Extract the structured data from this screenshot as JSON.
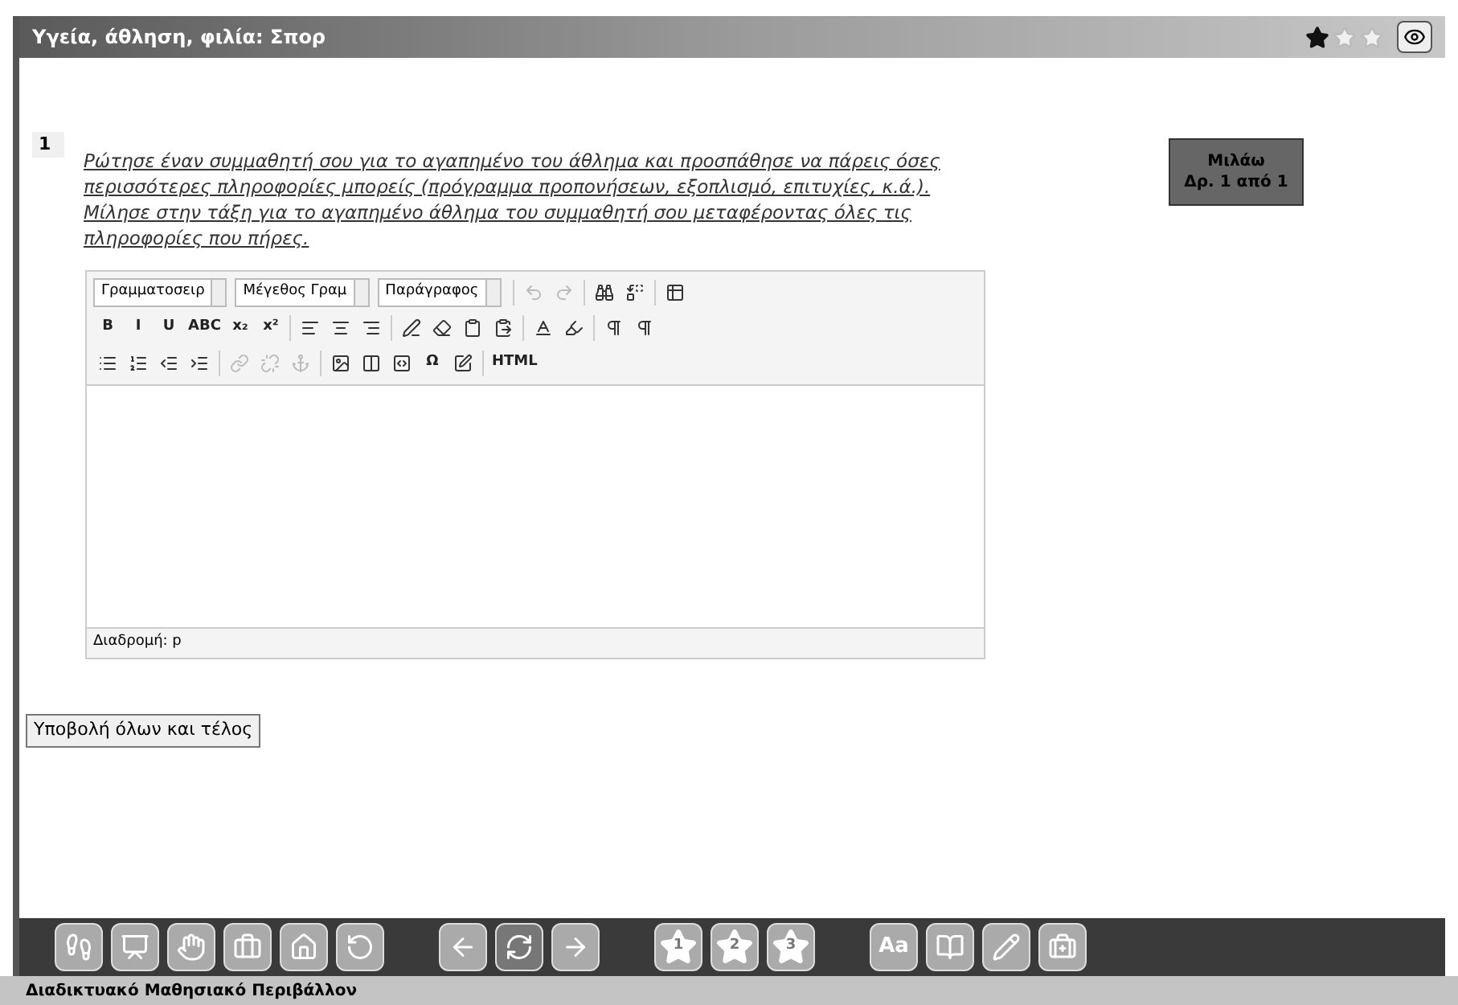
{
  "title_bar": {
    "title": "Υγεία, άθληση, φιλία: Σπορ",
    "stars": 1
  },
  "question": {
    "number": "1",
    "text": "Ρώτησε έναν συμμαθητή σου για το αγαπημένο του άθλημα και προσπάθησε να πάρεις όσες περισσότερες πληροφορίες μπορείς (πρόγραμμα προπονήσεων, εξοπλισμό, επιτυχίες, κ.ά.). Μίλησε στην τάξη για το αγαπημένο άθλημα του συμμαθητή σου μεταφέροντας όλες τις πληροφορίες που πήρες."
  },
  "speak_button": {
    "line_1": "Μιλάω",
    "line_2": "Δρ. 1 από 1"
  },
  "editor": {
    "toolbar_rows": [
      [
        {
          "kind": "dropdown",
          "label": "Γραμματοσειρ"
        },
        {
          "kind": "dropdown",
          "label": "Μέγεθος Γραμ"
        },
        {
          "kind": "dropdown",
          "label": "Παράγραφος"
        },
        {
          "kind": "sep"
        },
        {
          "kind": "icon",
          "disabled": true
        },
        {
          "kind": "icon",
          "disabled": true
        },
        {
          "kind": "sep"
        },
        {
          "kind": "icon",
          "disabled": false
        },
        {
          "kind": "icon",
          "disabled": false
        },
        {
          "kind": "sep"
        },
        {
          "kind": "icon",
          "disabled": false
        }
      ],
      [
        {
          "kind": "text",
          "label": "B",
          "disabled": false
        },
        {
          "kind": "text",
          "label": "I",
          "disabled": false
        },
        {
          "kind": "text",
          "label": "U",
          "disabled": false
        },
        {
          "kind": "text",
          "label": "ABC",
          "disabled": false
        },
        {
          "kind": "text",
          "label": "x₂",
          "disabled": false
        },
        {
          "kind": "text",
          "label": "x²",
          "disabled": false
        },
        {
          "kind": "sep"
        },
        {
          "kind": "icon",
          "disabled": false
        },
        {
          "kind": "icon",
          "disabled": false
        },
        {
          "kind": "icon",
          "disabled": false
        },
        {
          "kind": "sep"
        },
        {
          "kind": "icon",
          "disabled": false
        },
        {
          "kind": "icon",
          "disabled": false
        },
        {
          "kind": "icon",
          "disabled": false
        },
        {
          "kind": "icon",
          "disabled": false
        },
        {
          "kind": "sep"
        },
        {
          "kind": "icon",
          "disabled": false
        },
        {
          "kind": "icon",
          "disabled": false
        },
        {
          "kind": "sep"
        },
        {
          "kind": "icon",
          "disabled": false
        },
        {
          "kind": "icon",
          "disabled": false
        }
      ],
      [
        {
          "kind": "icon",
          "disabled": false
        },
        {
          "kind": "icon",
          "disabled": false
        },
        {
          "kind": "icon",
          "disabled": false
        },
        {
          "kind": "icon",
          "disabled": false
        },
        {
          "kind": "sep"
        },
        {
          "kind": "icon",
          "disabled": true
        },
        {
          "kind": "icon",
          "disabled": true
        },
        {
          "kind": "icon",
          "disabled": true
        },
        {
          "kind": "sep"
        },
        {
          "kind": "icon",
          "disabled": false
        },
        {
          "kind": "icon",
          "disabled": false
        },
        {
          "kind": "icon",
          "disabled": false
        },
        {
          "kind": "text",
          "label": "Ω",
          "disabled": false
        },
        {
          "kind": "icon",
          "disabled": false
        },
        {
          "kind": "sep"
        },
        {
          "kind": "text",
          "label": "HTML",
          "disabled": false
        }
      ]
    ],
    "path_label": "Διαδρομή: p"
  },
  "submit_button": "Υποβολή όλων και τέλος",
  "bottom_toolbar": [
    [
      {
        "kind": "icon",
        "selected": false
      },
      {
        "kind": "icon",
        "selected": false
      },
      {
        "kind": "icon",
        "selected": false
      },
      {
        "kind": "icon",
        "selected": false
      },
      {
        "kind": "icon",
        "selected": false
      },
      {
        "kind": "icon",
        "selected": false
      }
    ],
    [
      {
        "kind": "icon",
        "selected": false
      },
      {
        "kind": "icon",
        "selected": true
      },
      {
        "kind": "icon",
        "selected": false
      }
    ],
    [
      {
        "kind": "star",
        "label": "1",
        "selected": false
      },
      {
        "kind": "star",
        "label": "2",
        "selected": false
      },
      {
        "kind": "star",
        "label": "3",
        "selected": false
      }
    ],
    [
      {
        "kind": "text",
        "label": "Aa",
        "selected": false
      },
      {
        "kind": "icon",
        "selected": false
      },
      {
        "kind": "icon",
        "selected": false
      },
      {
        "kind": "icon",
        "selected": false
      }
    ]
  ],
  "footer": "Διαδικτυακό Μαθησιακό Περιβάλλον"
}
